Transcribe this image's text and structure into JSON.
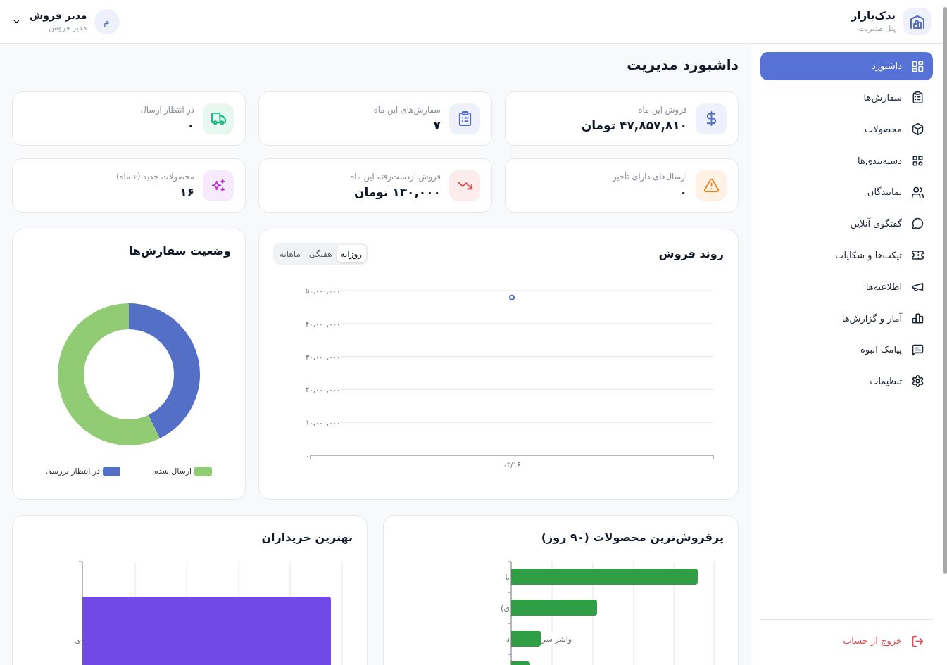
{
  "header": {
    "brand": {
      "name": "یدک‌بازار",
      "subtitle": "پنل مدیریت"
    },
    "user": {
      "avatar_letter": "م",
      "name": "مدیر فروش",
      "role": "مدیر فروش"
    }
  },
  "sidebar": {
    "items": [
      {
        "label": "داشبورد",
        "selected": true
      },
      {
        "label": "سفارش‌ها",
        "selected": false
      },
      {
        "label": "محصولات",
        "selected": false
      },
      {
        "label": "دسته‌بندی‌ها",
        "selected": false
      },
      {
        "label": "نمایندگان",
        "selected": false
      },
      {
        "label": "گفتگوی آنلاین",
        "selected": false
      },
      {
        "label": "تیکت‌ها و شکایات",
        "selected": false
      },
      {
        "label": "اطلاعیه‌ها",
        "selected": false
      },
      {
        "label": "آمار و گزارش‌ها",
        "selected": false
      },
      {
        "label": "پیامک انبوه",
        "selected": false
      },
      {
        "label": "تنظیمات",
        "selected": false
      }
    ],
    "logout": "خروج از حساب"
  },
  "page_title": "داشبورد مدیریت",
  "stats": [
    {
      "label": "فروش این ماه",
      "value": "۴۷,۸۵۷,۸۱۰ تومان"
    },
    {
      "label": "سفارش‌های این ماه",
      "value": "۷"
    },
    {
      "label": "در انتظار ارسال",
      "value": "۰"
    },
    {
      "label": "ارسال‌های دارای تأخیر",
      "value": "۰"
    },
    {
      "label": "فروش ازدست‌رفته این ماه",
      "value": "۱۳۰,۰۰۰ تومان"
    },
    {
      "label": "محصولات جدید (۶ ماه)",
      "value": "۱۶"
    }
  ],
  "sales_trend": {
    "title": "روند فروش",
    "tabs": [
      {
        "label": "روزانه",
        "selected": true
      },
      {
        "label": "هفتگی",
        "selected": false
      },
      {
        "label": "ماهانه",
        "selected": false
      }
    ],
    "chart_data": {
      "type": "line",
      "x": [
        "۰۳/۱۶"
      ],
      "series": [
        {
          "color": "#5470c6",
          "marker": true,
          "values": [
            47900000
          ]
        }
      ],
      "ylim": [
        0,
        50000000
      ],
      "yticks": [
        {
          "value": 0,
          "label": "۰"
        },
        {
          "value": 10000000,
          "label": "۱۰,۰۰۰,۰۰۰"
        },
        {
          "value": 20000000,
          "label": "۲۰,۰۰۰,۰۰۰"
        },
        {
          "value": 30000000,
          "label": "۳۰,۰۰۰,۰۰۰"
        },
        {
          "value": 40000000,
          "label": "۴۰,۰۰۰,۰۰۰"
        },
        {
          "value": 50000000,
          "label": "۵۰,۰۰۰,۰۰۰"
        }
      ],
      "grid": true
    }
  },
  "order_status": {
    "title": "وضعیت سفارش‌ها",
    "legend": [
      {
        "label": "ارسال شده",
        "color": "#91cc75"
      },
      {
        "label": "در انتظار بررسی",
        "color": "#5470c6"
      }
    ]
  },
  "top_products": {
    "title": "پرفروش‌ترین محصولات (۹۰ روز)",
    "rows": [
      {
        "axis_label": "یا"
      },
      {
        "axis_label": "ی)"
      },
      {
        "axis_label": "د",
        "trailing_text": "واشر سر"
      }
    ]
  },
  "top_buyers": {
    "title": "بهترین خریداران",
    "rows": [
      {
        "axis_label": "ی"
      }
    ]
  }
}
